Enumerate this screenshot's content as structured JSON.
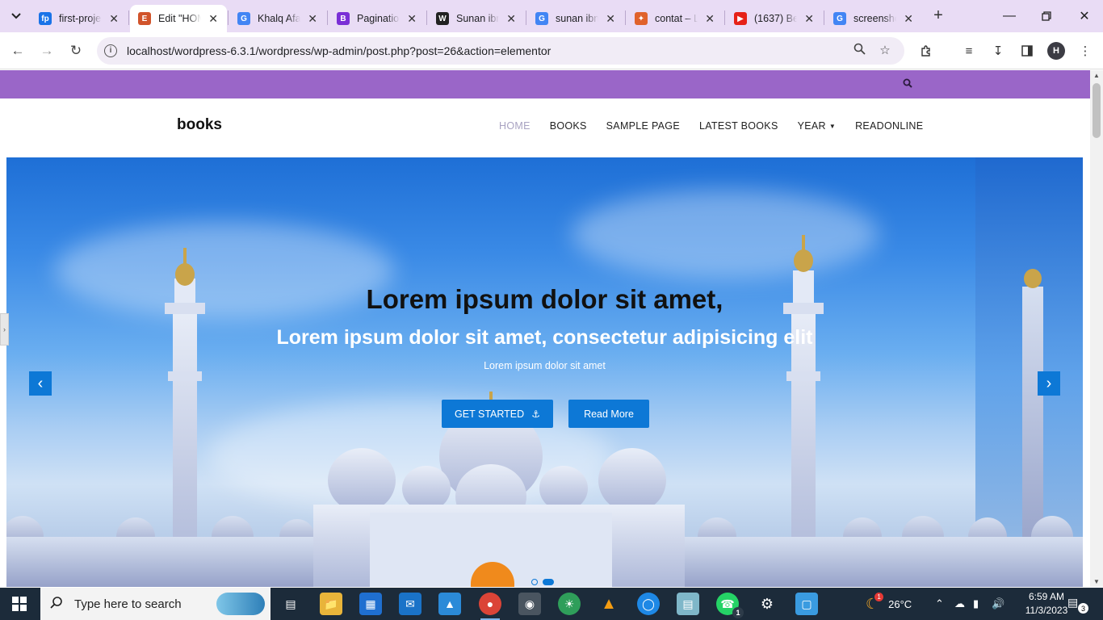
{
  "browser": {
    "tabs": [
      {
        "title": "first-proje",
        "favicon": "fp",
        "color": "#1a73e8",
        "active": false
      },
      {
        "title": "Edit \"HOM",
        "favicon": "E",
        "color": "#d1542b",
        "active": true
      },
      {
        "title": "Khalq Afa",
        "favicon": "G",
        "color": "#4285f4",
        "active": false
      },
      {
        "title": "Paginatio",
        "favicon": "B",
        "color": "#7a2fd6",
        "active": false
      },
      {
        "title": "Sunan ibn",
        "favicon": "W",
        "color": "#222222",
        "active": false
      },
      {
        "title": "sunan ibn",
        "favicon": "G",
        "color": "#4285f4",
        "active": false
      },
      {
        "title": "contat – L",
        "favicon": "✦",
        "color": "#e0622b",
        "active": false
      },
      {
        "title": "(1637) Be",
        "favicon": "▶",
        "color": "#e62117",
        "active": false
      },
      {
        "title": "screensho",
        "favicon": "G",
        "color": "#4285f4",
        "active": false
      }
    ],
    "url": "localhost/wordpress-6.3.1/wordpress/wp-admin/post.php?post=26&action=elementor",
    "profile_initial": "H"
  },
  "page": {
    "brand": "books",
    "menu": [
      "HOME",
      "BOOKS",
      "SAMPLE PAGE",
      "LATEST BOOKS",
      "YEAR",
      "READONLINE"
    ],
    "hero": {
      "title": "Lorem ipsum dolor sit amet,",
      "subtitle": "Lorem ipsum dolor sit amet, consectetur adipisicing elit",
      "text": "Lorem ipsum dolor sit amet",
      "primary_button": "GET STARTED",
      "secondary_button": "Read More"
    },
    "colors": {
      "topbar": "#9a66c8",
      "accent": "#0d78d6"
    }
  },
  "taskbar": {
    "search_placeholder": "Type here to search",
    "weather": "26°C",
    "time": "6:59 AM",
    "date": "11/3/2023",
    "notification_count": "3",
    "whatsapp_badge": "1",
    "weather_badge": "1"
  }
}
